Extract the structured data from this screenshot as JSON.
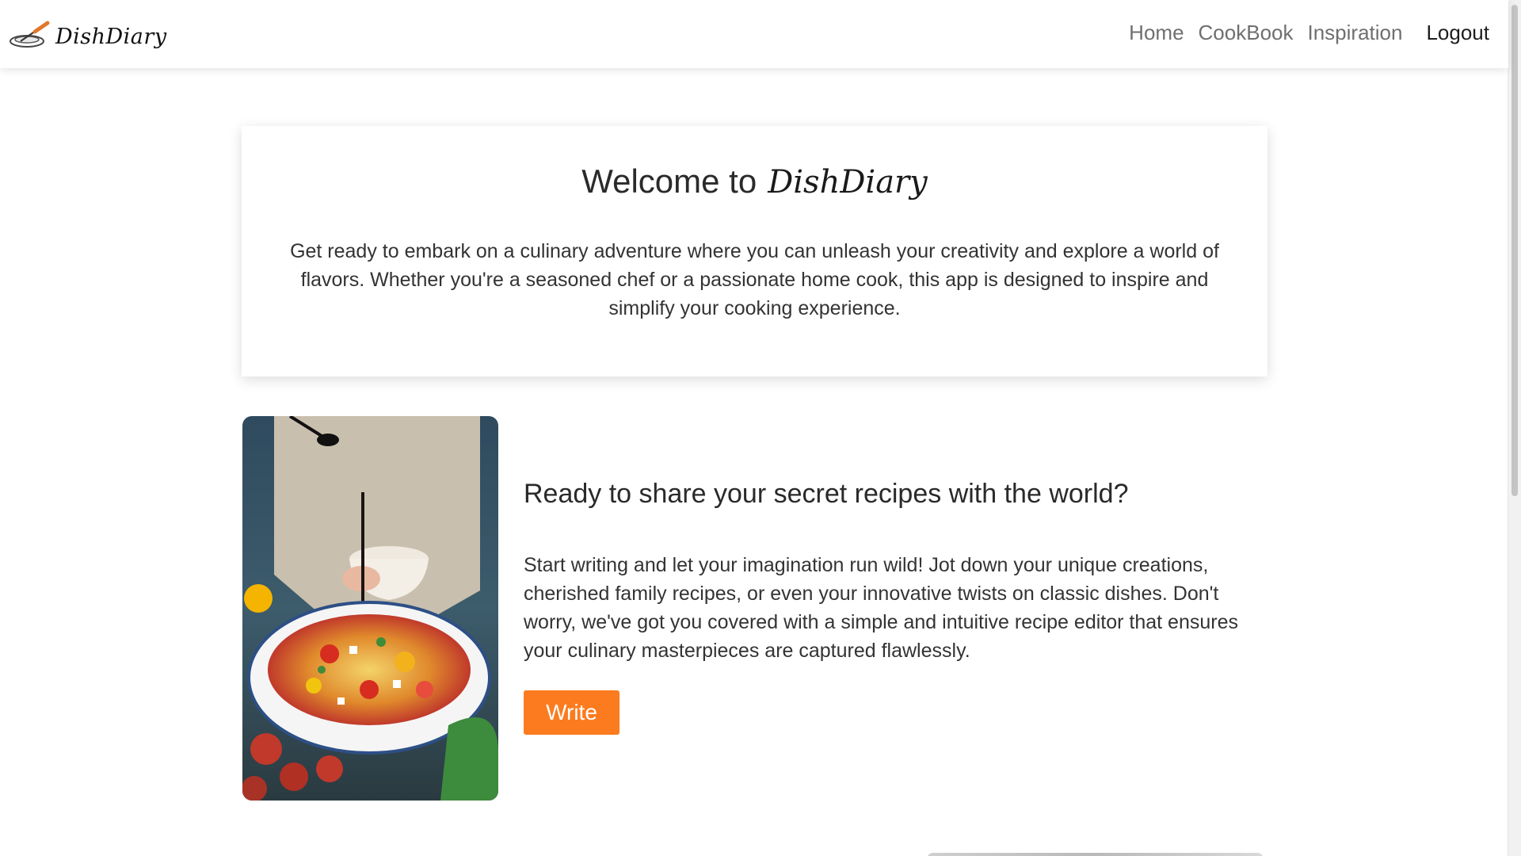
{
  "brand": {
    "name": "DishDiary",
    "logo_icon": "pot-with-spoon-icon"
  },
  "nav": {
    "links": [
      {
        "label": "Home"
      },
      {
        "label": "CookBook"
      },
      {
        "label": "Inspiration"
      }
    ],
    "logout_label": "Logout"
  },
  "welcome": {
    "title_prefix": "Welcome to",
    "title_brand": "DishDiary",
    "text": "Get ready to embark on a culinary adventure where you can unleash your creativity and explore a world of flavors. Whether you're a seasoned chef or a passionate home cook, this app is designed to inspire and simplify your cooking experience."
  },
  "feature": {
    "image_subject": "salad-bowl-photo",
    "heading": "Ready to share your secret recipes with the world?",
    "text": "Start writing and let your imagination run wild! Jot down your unique creations, cherished family recipes, or even your innovative twists on classic dishes. Don't worry, we've got you covered with a simple and intuitive recipe editor that ensures your culinary masterpieces are captured flawlessly.",
    "button_label": "Write"
  },
  "colors": {
    "accent": "#fb7b1e",
    "nav_text": "#6f6f6f",
    "text": "#333333"
  }
}
